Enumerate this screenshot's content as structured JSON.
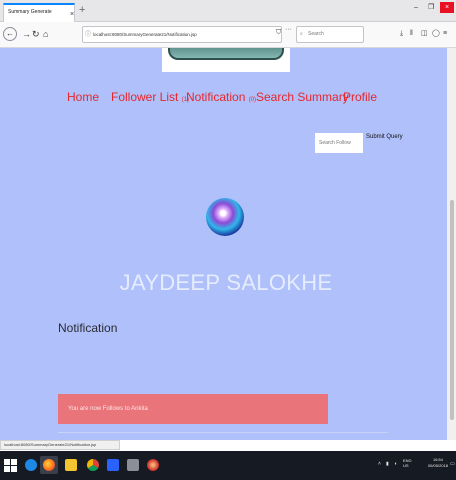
{
  "browser": {
    "tab_title": "Summary Generate",
    "tab_close": "×",
    "new_tab": "+",
    "url": "localhost:8080/SummaryGenerate21/Notification.jsp",
    "zoom": "110%",
    "url_extras": "···",
    "search_placeholder": "Search",
    "status_url": "localhost:8080/SummaryGenerate21/Notification.jsp",
    "window_minimize": "–",
    "window_restore": "❐",
    "window_close": "×"
  },
  "nav": {
    "items": [
      {
        "label": "Home"
      },
      {
        "label": "Follower List",
        "badge": "(1)"
      },
      {
        "label": "Notification",
        "badge": "(0)"
      },
      {
        "label": "Search Summary"
      },
      {
        "label": "Profile"
      }
    ]
  },
  "search": {
    "placeholder": "Search Follow",
    "submit_label": "Submit Query"
  },
  "profile": {
    "name": "JAYDEEP SALOKHE"
  },
  "notifications": {
    "title": "Notification",
    "items": [
      "You are now Follows to Ankita"
    ]
  },
  "taskbar": {
    "language": "ENG",
    "region": "US",
    "time": "16:54",
    "date": "06/05/2018"
  },
  "colors": {
    "page_background": "#b0c0fa",
    "nav_link": "#e8262c",
    "notification_row": "#e9757a"
  }
}
